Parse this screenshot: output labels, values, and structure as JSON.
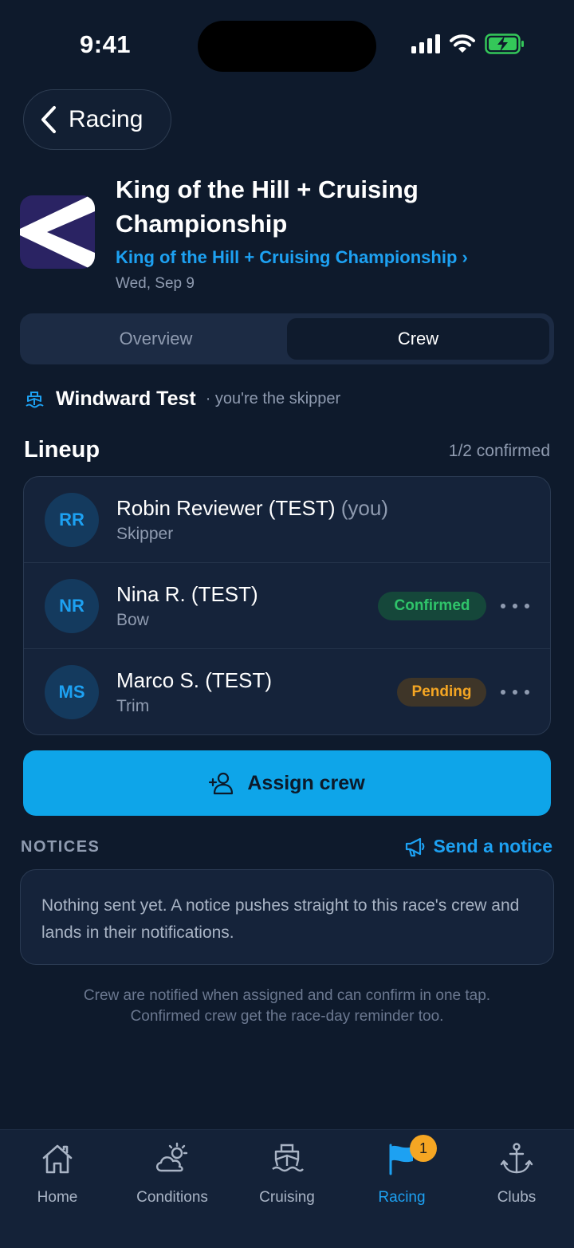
{
  "status_bar": {
    "time": "9:41"
  },
  "nav": {
    "back_label": "Racing"
  },
  "event": {
    "title": "King of the Hill + Cruising Championship",
    "series_link": "King of the Hill + Cruising Championship ›",
    "date": "Wed, Sep 9"
  },
  "segments": [
    {
      "label": "Overview",
      "active": false
    },
    {
      "label": "Crew",
      "active": true
    }
  ],
  "boat": {
    "name": "Windward Test",
    "note": "· you're the skipper"
  },
  "lineup": {
    "title": "Lineup",
    "count": "1/2 confirmed",
    "members": [
      {
        "initials": "RR",
        "name": "Robin Reviewer (TEST)",
        "you_tag": "(you)",
        "role": "Skipper",
        "status": ""
      },
      {
        "initials": "NR",
        "name": "Nina R. (TEST)",
        "you_tag": "",
        "role": "Bow",
        "status": "Confirmed"
      },
      {
        "initials": "MS",
        "name": "Marco S. (TEST)",
        "you_tag": "",
        "role": "Trim",
        "status": "Pending"
      }
    ]
  },
  "assign": {
    "label": "Assign crew"
  },
  "notices": {
    "title": "NOTICES",
    "send_label": "Send a notice",
    "empty_text": "Nothing sent yet. A notice pushes straight to this race's crew and lands in their notifications."
  },
  "footer_note": {
    "line1": "Crew are notified when assigned and can confirm in one tap.",
    "line2": "Confirmed crew get the race-day reminder too."
  },
  "tabbar": {
    "items": [
      {
        "label": "Home",
        "icon": "home-icon",
        "active": false
      },
      {
        "label": "Conditions",
        "icon": "weather-icon",
        "active": false
      },
      {
        "label": "Cruising",
        "icon": "boat-icon",
        "active": false
      },
      {
        "label": "Racing",
        "icon": "flag-icon",
        "active": true,
        "badge": "1"
      },
      {
        "label": "Clubs",
        "icon": "anchor-icon",
        "active": false
      }
    ]
  },
  "colors": {
    "background": "#0e1a2c",
    "accent": "#1da1f2",
    "primary_button": "#0ea5e9",
    "confirmed": "#2fc46a",
    "pending": "#f5a623"
  }
}
